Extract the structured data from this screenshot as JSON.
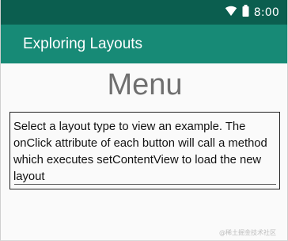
{
  "status_bar": {
    "time": "8:00",
    "icons": [
      "wifi-icon",
      "battery-icon"
    ]
  },
  "app_bar": {
    "title": "Exploring Layouts"
  },
  "main": {
    "title": "Menu",
    "description": "Select a layout type to view an example. The onClick attribute of each button will call a method which executes setContentView to load the new layout"
  },
  "watermark": "@稀土掘金技术社区",
  "colors": {
    "status_bar_bg": "#0b5e4f",
    "app_bar_bg": "#178a76",
    "title_text": "#6f6f6f"
  }
}
